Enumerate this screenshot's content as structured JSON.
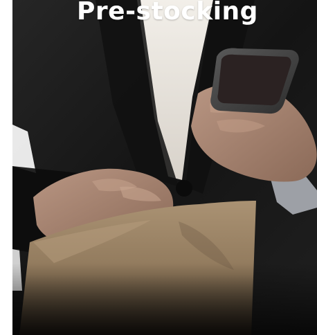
{
  "card": {
    "title": "Pre-stocking"
  },
  "colors": {
    "title_text": "#ffffff",
    "suit": "#1c1c1c",
    "shirt": "#e7e2dc",
    "paper_bag": "#9b8466",
    "skin": "#a9836d",
    "phone_body": "#3f3f40",
    "phone_screen": "#2b2222"
  },
  "icons": {
    "photo": "businessman-holding-phone-and-paper-bag-photo"
  }
}
